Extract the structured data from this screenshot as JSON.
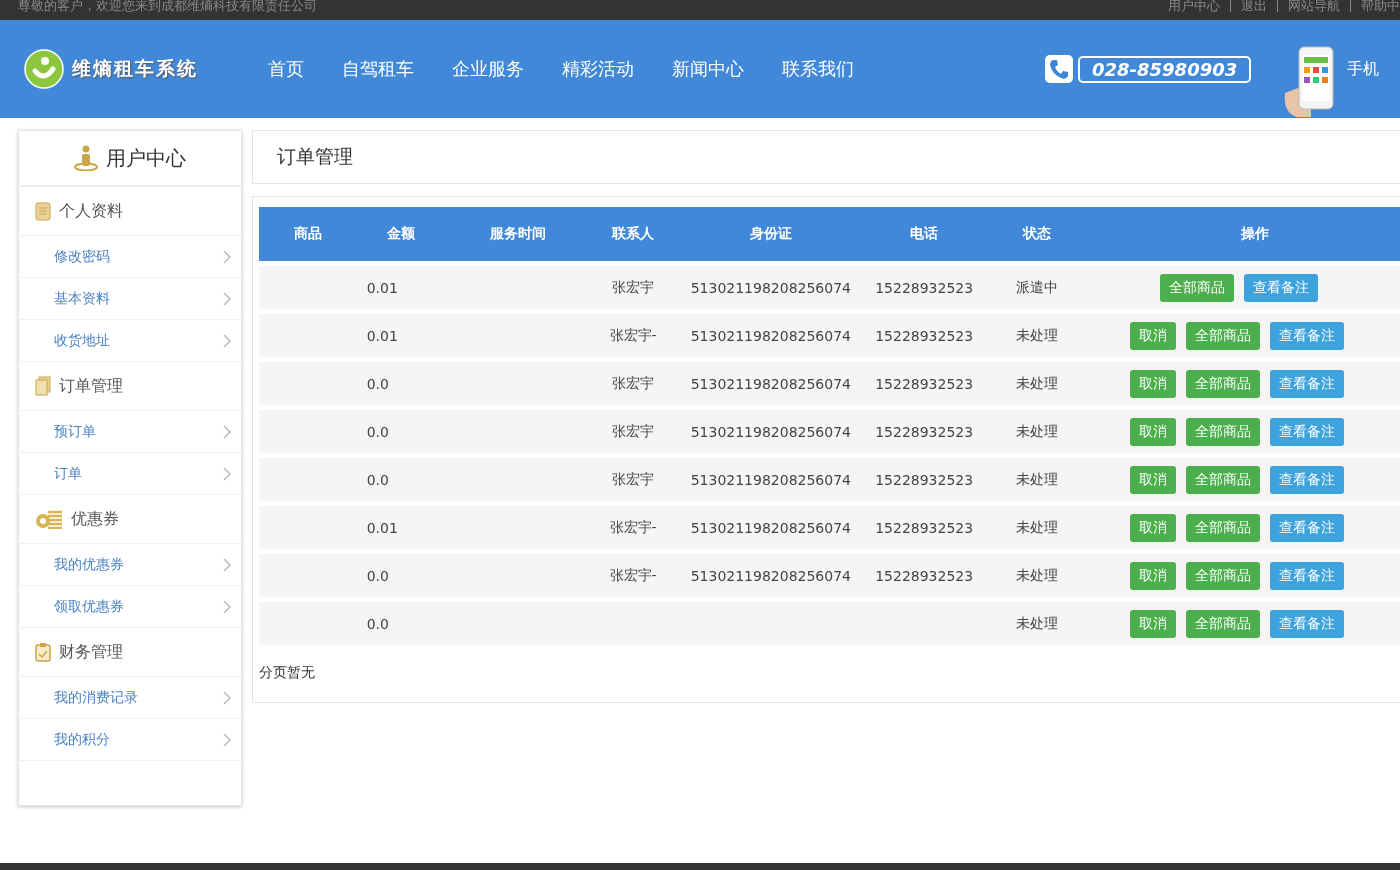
{
  "top_bar": {
    "welcome": "尊敬的客户，欢迎您来到成都维熵科技有限责任公司",
    "links": [
      "用户中心",
      "退出",
      "网站导航",
      "帮助中"
    ]
  },
  "header": {
    "logo": "维熵租车系统",
    "nav": [
      {
        "label": "首页"
      },
      {
        "label": "自驾租车"
      },
      {
        "label": "企业服务"
      },
      {
        "label": "精彩活动"
      },
      {
        "label": "新闻中心"
      },
      {
        "label": "联系我们"
      }
    ],
    "phone": "028-85980903",
    "mobile": "手机"
  },
  "sidebar": {
    "title": "用户中心",
    "groups": [
      {
        "title": "个人资料",
        "kind": "notepad",
        "items": [
          "修改密码",
          "基本资料",
          "收货地址"
        ]
      },
      {
        "title": "订单管理",
        "kind": "documents",
        "items": [
          "预订单",
          "订单"
        ]
      },
      {
        "title": "优惠券",
        "kind": "coins",
        "items": [
          "我的优惠券",
          "领取优惠券"
        ]
      },
      {
        "title": "财务管理",
        "kind": "clipboard",
        "items": [
          "我的消费记录",
          "我的积分"
        ]
      }
    ]
  },
  "main": {
    "title": "订单管理",
    "table": {
      "columns": [
        "商品",
        "金额",
        "服务时间",
        "联系人",
        "身份证",
        "电话",
        "状态",
        "操作"
      ],
      "rows": [
        {
          "amount": "0.01",
          "contact": "张宏宇",
          "id": "513021198208256074",
          "phone": "15228932523",
          "status": "派遣中",
          "actions": [
            {
              "label": "全部商品",
              "kind": "green"
            },
            {
              "label": "查看备注",
              "kind": "blue"
            }
          ]
        },
        {
          "amount": "0.01",
          "contact": "张宏宇-",
          "id": "513021198208256074",
          "phone": "15228932523",
          "status": "未处理",
          "actions": [
            {
              "label": "取消",
              "kind": "green"
            },
            {
              "label": "全部商品",
              "kind": "green"
            },
            {
              "label": "查看备注",
              "kind": "blue"
            }
          ]
        },
        {
          "amount": "0.0",
          "contact": "张宏宇",
          "id": "513021198208256074",
          "phone": "15228932523",
          "status": "未处理",
          "actions": [
            {
              "label": "取消",
              "kind": "green"
            },
            {
              "label": "全部商品",
              "kind": "green"
            },
            {
              "label": "查看备注",
              "kind": "blue"
            }
          ]
        },
        {
          "amount": "0.0",
          "contact": "张宏宇",
          "id": "513021198208256074",
          "phone": "15228932523",
          "status": "未处理",
          "actions": [
            {
              "label": "取消",
              "kind": "green"
            },
            {
              "label": "全部商品",
              "kind": "green"
            },
            {
              "label": "查看备注",
              "kind": "blue"
            }
          ]
        },
        {
          "amount": "0.0",
          "contact": "张宏宇",
          "id": "513021198208256074",
          "phone": "15228932523",
          "status": "未处理",
          "actions": [
            {
              "label": "取消",
              "kind": "green"
            },
            {
              "label": "全部商品",
              "kind": "green"
            },
            {
              "label": "查看备注",
              "kind": "blue"
            }
          ]
        },
        {
          "amount": "0.01",
          "contact": "张宏宇-",
          "id": "513021198208256074",
          "phone": "15228932523",
          "status": "未处理",
          "actions": [
            {
              "label": "取消",
              "kind": "green"
            },
            {
              "label": "全部商品",
              "kind": "green"
            },
            {
              "label": "查看备注",
              "kind": "blue"
            }
          ]
        },
        {
          "amount": "0.0",
          "contact": "张宏宇-",
          "id": "513021198208256074",
          "phone": "15228932523",
          "status": "未处理",
          "actions": [
            {
              "label": "取消",
              "kind": "green"
            },
            {
              "label": "全部商品",
              "kind": "green"
            },
            {
              "label": "查看备注",
              "kind": "blue"
            }
          ]
        },
        {
          "amount": "0.0",
          "status": "未处理",
          "actions": [
            {
              "label": "取消",
              "kind": "green"
            },
            {
              "label": "全部商品",
              "kind": "green"
            },
            {
              "label": "查看备注",
              "kind": "blue"
            }
          ]
        }
      ]
    },
    "pagination": "分页暂无"
  }
}
